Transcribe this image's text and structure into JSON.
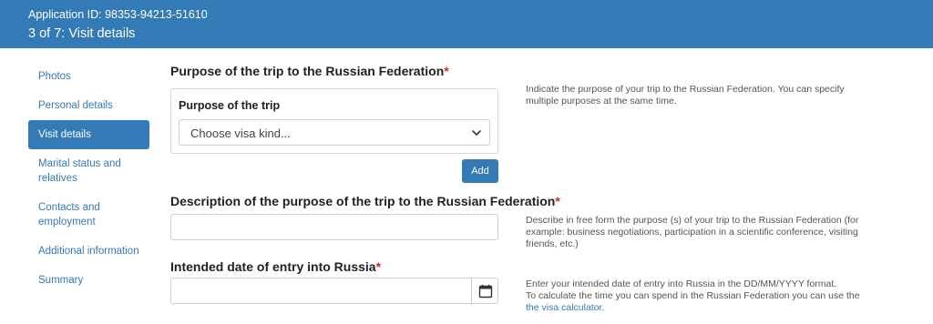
{
  "header": {
    "application_id": "Application ID: 98353-94213-51610",
    "step": "3 of 7: Visit details"
  },
  "sidebar": {
    "items": [
      {
        "label": "Photos"
      },
      {
        "label": "Personal details"
      },
      {
        "label": "Visit details",
        "active": true
      },
      {
        "label": "Marital status and relatives"
      },
      {
        "label": "Contacts and employment"
      },
      {
        "label": "Additional information"
      },
      {
        "label": "Summary"
      }
    ]
  },
  "purpose": {
    "title": "Purpose of the trip to the Russian Federation",
    "required_mark": "*",
    "panel_label": "Purpose of the trip",
    "select_value": "Choose visa kind...",
    "add_label": "Add",
    "help": "Indicate the purpose of your trip to the Russian Federation. You can specify multiple purposes at the same time."
  },
  "description": {
    "title": "Description of the purpose of the trip to the Russian Federation",
    "required_mark": "*",
    "value": "",
    "help": "Describe in free form the purpose (s) of your trip to the Russian Federation (for example: business negotiations, participation in a scientific conference, visiting friends, etc.)"
  },
  "entry_date": {
    "title": "Intended date of entry into Russia",
    "required_mark": "*",
    "value": "",
    "help_line1": "Enter your intended date of entry into Russia in the DD/MM/YYYY format.",
    "help_line2": "To calculate the time you can spend in the Russian Federation you can use the ",
    "help_link": "the visa calculator",
    "help_end": "."
  },
  "colors": {
    "accent": "#337ab7",
    "required": "#c9302c"
  },
  "icons": {
    "select": "chevron-down-icon",
    "date": "calendar-icon"
  }
}
